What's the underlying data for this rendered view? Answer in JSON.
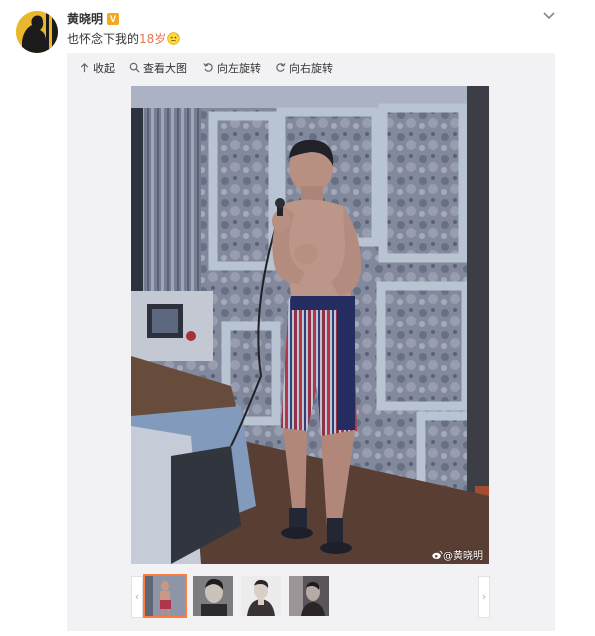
{
  "header": {
    "username": "黄晓明",
    "badge": "V",
    "avatar_icon": "user-avatar-icon",
    "menu_icon": "chevron-down-icon"
  },
  "post": {
    "text_before": "也怀念下我的",
    "highlight": "18岁",
    "emoji_icon": "sweat-emoji-icon",
    "highlight_color": "#eb7350"
  },
  "toolbar": {
    "collapse_label": "收起",
    "view_large_label": "查看大图",
    "rotate_left_label": "向左旋转",
    "rotate_right_label": "向右旋转"
  },
  "image": {
    "watermark": "@黄晓明",
    "watermark_icon": "weibo-logo-icon"
  },
  "thumbnails": {
    "prev_icon": "chevron-left-icon",
    "next_icon": "chevron-right-icon",
    "count": 4,
    "active_index": 0
  },
  "colors": {
    "accent": "#fa7d3c",
    "badge": "#f5a623",
    "panel": "#f2f2f5"
  }
}
